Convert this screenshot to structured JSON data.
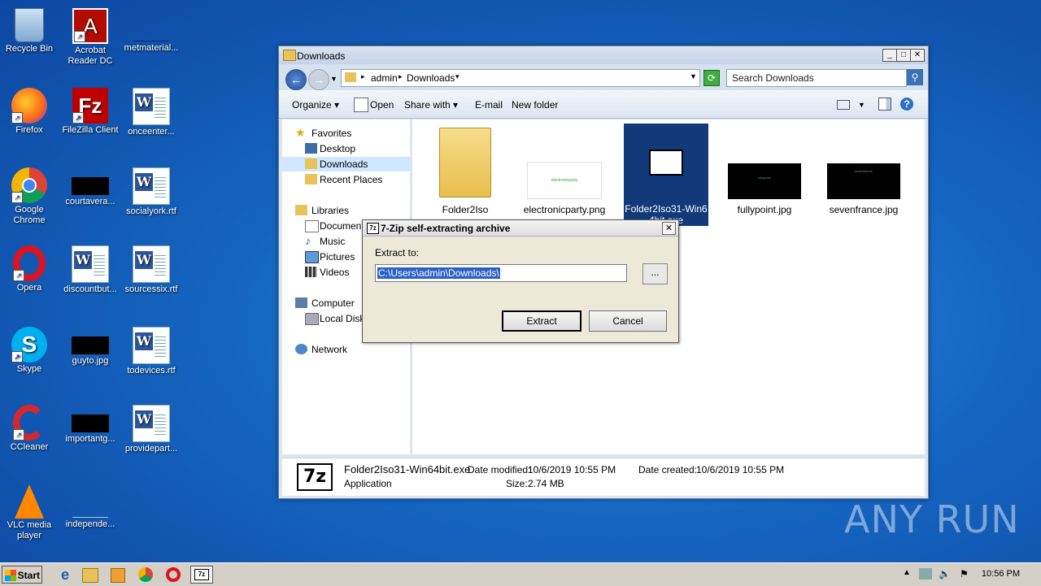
{
  "desktop": {
    "icons": [
      {
        "label": "Recycle Bin"
      },
      {
        "label": "Acrobat Reader DC"
      },
      {
        "label": "metmaterial..."
      },
      {
        "label": "Firefox"
      },
      {
        "label": "FileZilla Client"
      },
      {
        "label": "onceenter..."
      },
      {
        "label": "Google Chrome"
      },
      {
        "label": "courtavera..."
      },
      {
        "label": "socialyork.rtf"
      },
      {
        "label": "Opera"
      },
      {
        "label": "discountbut..."
      },
      {
        "label": "sourcessix.rtf"
      },
      {
        "label": "Skype"
      },
      {
        "label": "guyto.jpg"
      },
      {
        "label": "todevices.rtf"
      },
      {
        "label": "CCleaner"
      },
      {
        "label": "importantg..."
      },
      {
        "label": "providepart..."
      },
      {
        "label": "VLC media player"
      },
      {
        "label": "independe..."
      }
    ]
  },
  "explorer": {
    "title": "Downloads",
    "breadcrumb": [
      "admin",
      "Downloads"
    ],
    "search_placeholder": "Search Downloads",
    "toolbar": {
      "organize": "Organize",
      "open": "Open",
      "share_with": "Share with",
      "email": "E-mail",
      "new_folder": "New folder"
    },
    "nav": {
      "favorites": "Favorites",
      "desktop": "Desktop",
      "downloads": "Downloads",
      "recent_places": "Recent Places",
      "libraries": "Libraries",
      "documents": "Document",
      "music": "Music",
      "pictures": "Pictures",
      "videos": "Videos",
      "computer": "Computer",
      "local_disk": "Local Disk",
      "network": "Network"
    },
    "files": [
      {
        "name": "Folder2Iso"
      },
      {
        "name": "electronicparty.png",
        "thumb_text": "electronicparty"
      },
      {
        "name": "Folder2Iso31-Win64bit.exe",
        "name_visible": "Folder2Iso31-Win6 4bit.exe"
      },
      {
        "name": "fullypoint.jpg",
        "thumb_text": "fullypoint"
      },
      {
        "name": "sevenfrance.jpg",
        "thumb_text": "sevenfrance"
      }
    ],
    "details": {
      "filename": "Folder2Iso31-Win64bit.exe",
      "type": "Application",
      "modified_label": "Date modified:",
      "modified": "10/6/2019 10:55 PM",
      "created_label": "Date created:",
      "created": "10/6/2019 10:55 PM",
      "size_label": "Size:",
      "size": "2.74 MB"
    }
  },
  "dialog": {
    "title": "7-Zip self-extracting archive",
    "extract_to_label": "Extract to:",
    "path_value": "C:\\Users\\admin\\Downloads\\",
    "browse_label": "...",
    "extract_button": "Extract",
    "cancel_button": "Cancel"
  },
  "taskbar": {
    "start_label": "Start",
    "clock": "10:56 PM"
  },
  "zip_logo_text": "7z",
  "watermark": "ANY RUN"
}
